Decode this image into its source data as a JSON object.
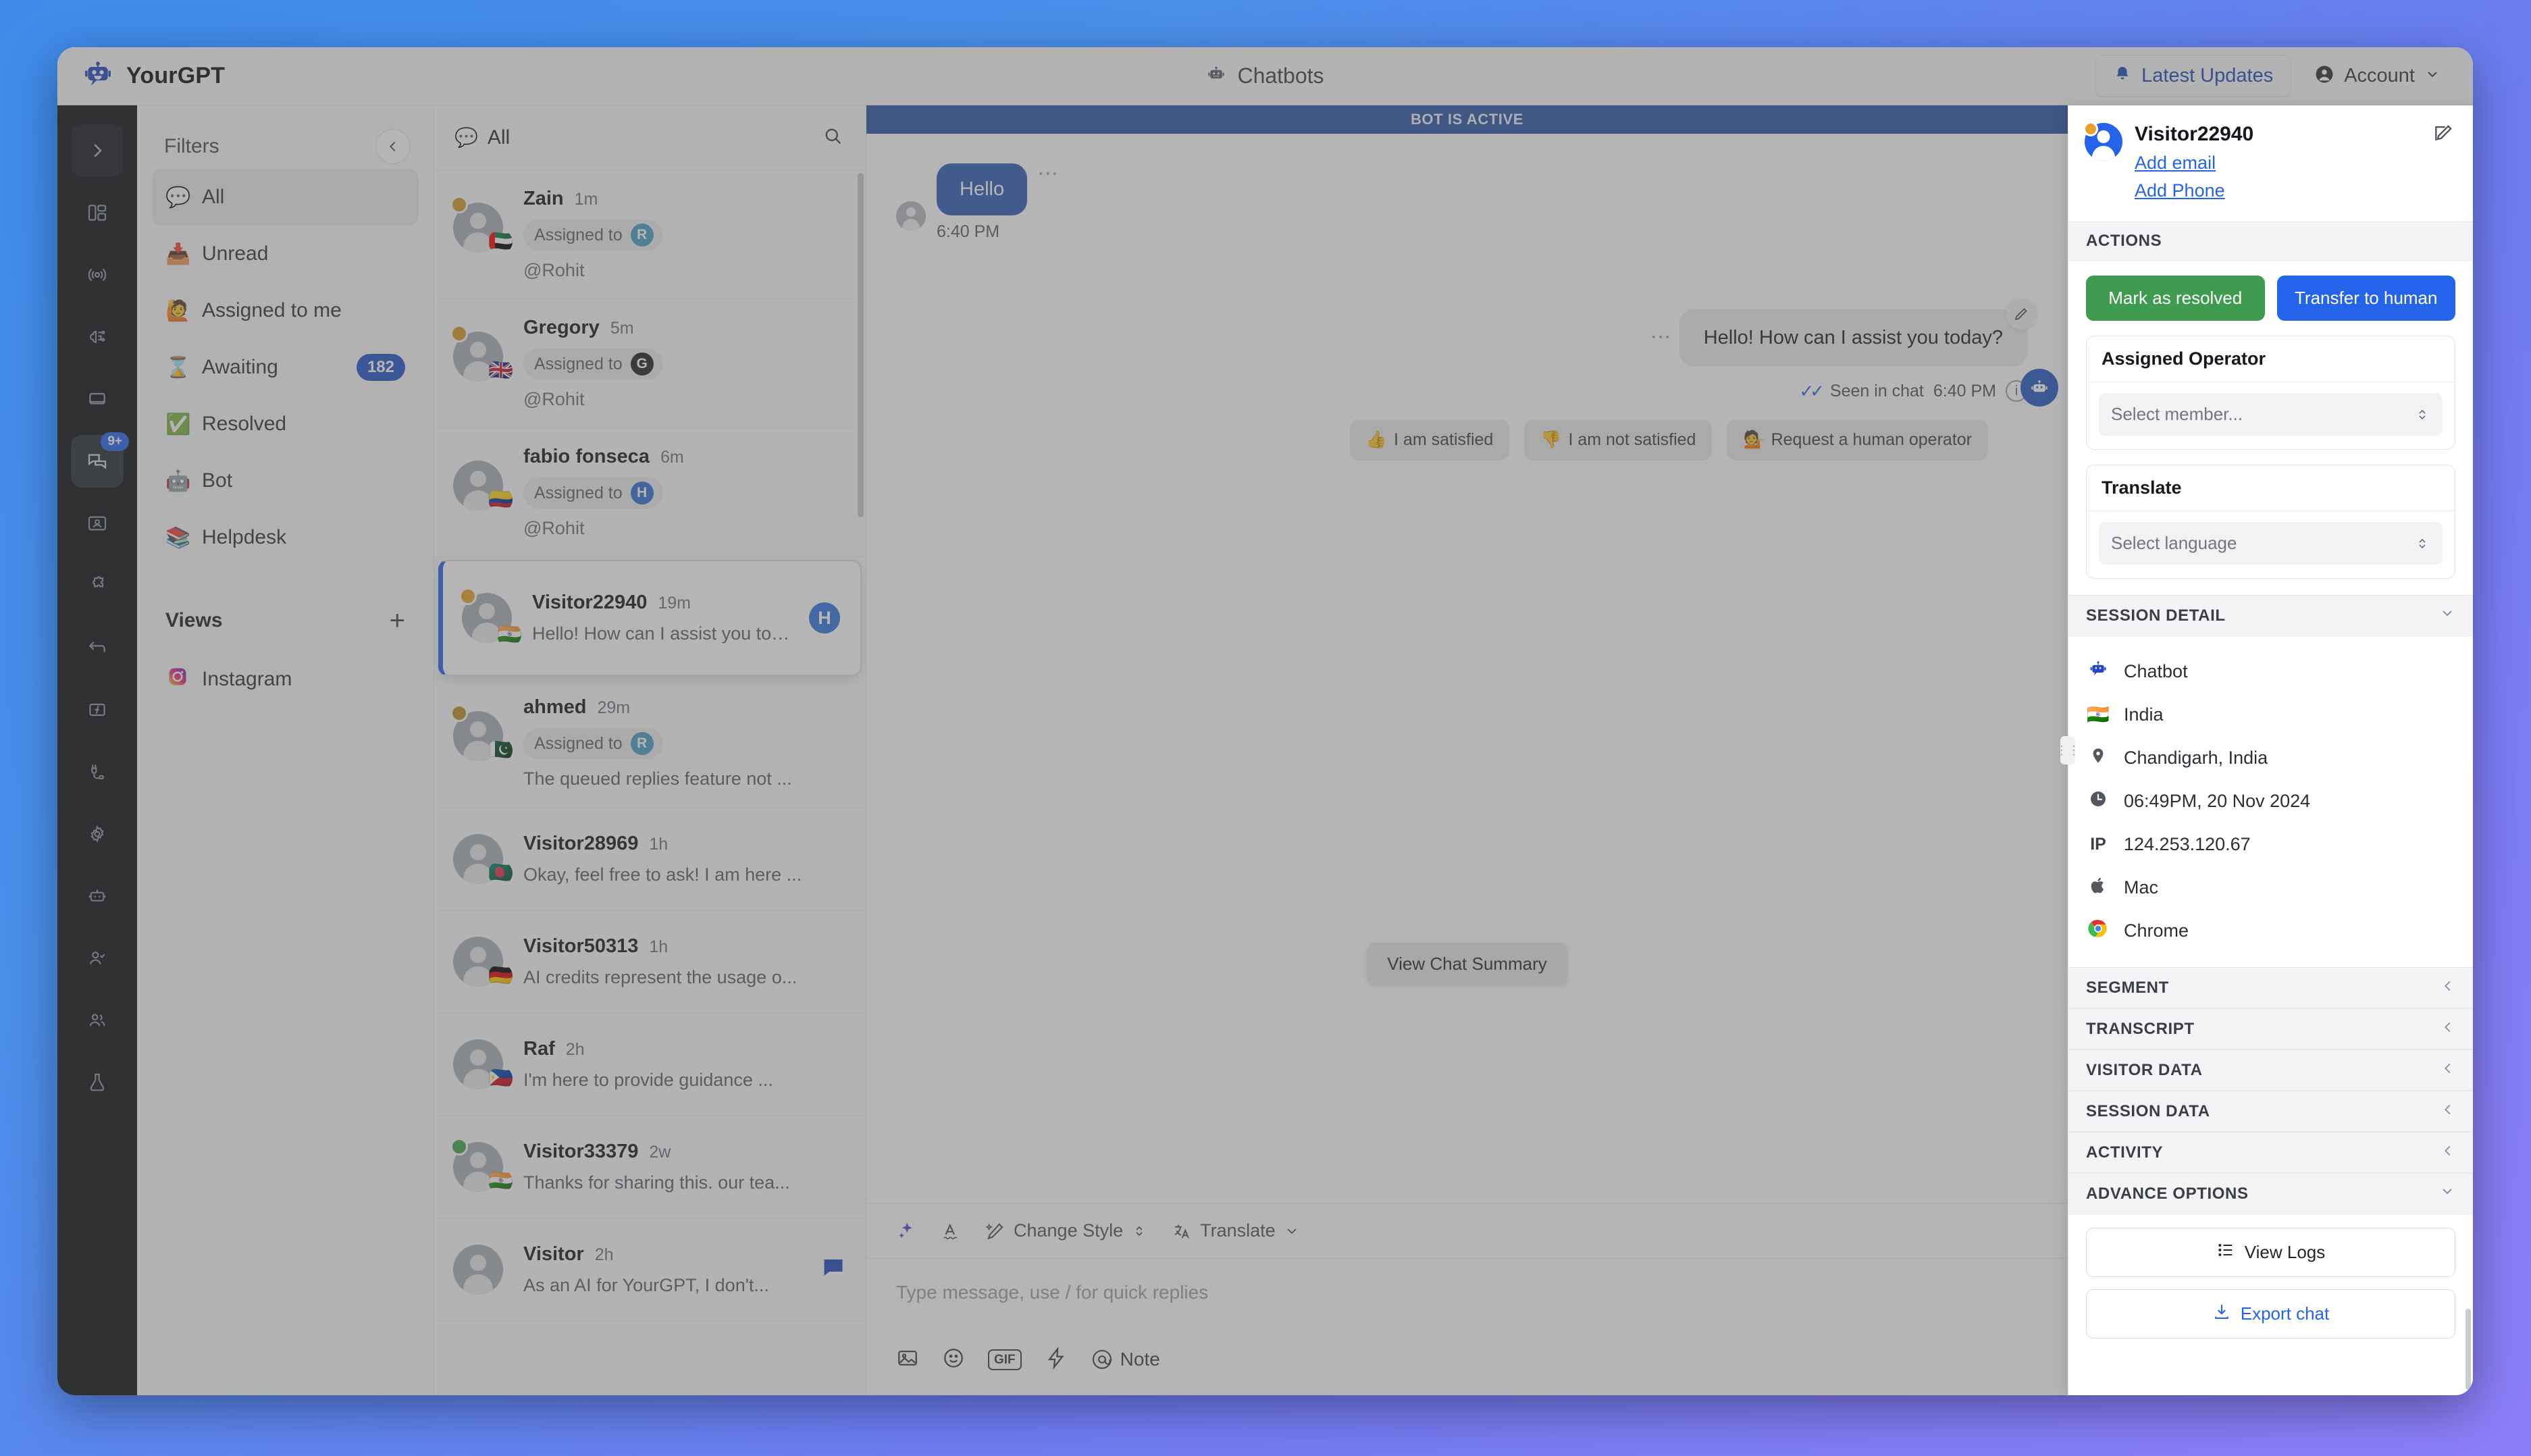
{
  "topbar": {
    "brand": "YourGPT",
    "brand_icon": "robot-logo-icon",
    "page_title": "Chatbots",
    "page_title_icon": "robot-icon",
    "updates_label": "Latest Updates",
    "updates_icon": "bell-icon",
    "account_label": "Account",
    "account_icon": "user-circle-icon",
    "account_caret": "chevron-down-icon"
  },
  "rail": {
    "items": [
      {
        "name": "expand-rail",
        "glyph": "›",
        "boxed": true
      },
      {
        "name": "dashboard",
        "glyph": "dashboard"
      },
      {
        "name": "broadcast",
        "glyph": "broadcast"
      },
      {
        "name": "ai-brain",
        "glyph": "brain"
      },
      {
        "name": "widget",
        "glyph": "widget"
      },
      {
        "name": "conversations",
        "glyph": "chats",
        "badge": "9+",
        "active": true
      },
      {
        "name": "contacts",
        "glyph": "contact-card"
      },
      {
        "name": "integrations",
        "glyph": "puzzle"
      },
      {
        "name": "back-arrow",
        "glyph": "arrow-left"
      },
      {
        "name": "functions",
        "glyph": "function"
      },
      {
        "name": "plugins",
        "glyph": "plug"
      },
      {
        "name": "settings",
        "glyph": "gear"
      },
      {
        "name": "bots",
        "glyph": "bot"
      },
      {
        "name": "agents",
        "glyph": "user-check"
      },
      {
        "name": "team",
        "glyph": "users"
      },
      {
        "name": "labs",
        "glyph": "flask"
      }
    ]
  },
  "filters": {
    "title": "Filters",
    "collapse_icon": "chevron-left-icon",
    "items": [
      {
        "emoji": "💬",
        "label": "All",
        "selected": true,
        "badge": null
      },
      {
        "emoji": "📥",
        "label": "Unread",
        "selected": false,
        "badge": null
      },
      {
        "emoji": "🙋",
        "label": "Assigned to me",
        "selected": false,
        "badge": null
      },
      {
        "emoji": "⌛",
        "label": "Awaiting",
        "selected": false,
        "badge": "182"
      },
      {
        "emoji": "✅",
        "label": "Resolved",
        "selected": false,
        "badge": null
      },
      {
        "emoji": "🤖",
        "label": "Bot",
        "selected": false,
        "badge": null
      },
      {
        "emoji": "📚",
        "label": "Helpdesk",
        "selected": false,
        "badge": null
      }
    ],
    "views_title": "Views",
    "views_add_icon": "plus-icon",
    "views": [
      {
        "emoji": "📷",
        "label": "Instagram"
      }
    ]
  },
  "conversations": {
    "header_label": "All",
    "header_emoji": "💬",
    "search_icon": "search-icon",
    "items": [
      {
        "name": "Zain",
        "time": "1m",
        "status_color": "#d9962a",
        "flag": "🇦🇪",
        "assigned_label": "Assigned to",
        "assignee_initial": "R",
        "assignee_color": "#4a9ec4",
        "handle": "@Rohit",
        "snippet": null,
        "right_avatar": null,
        "unread": false,
        "selected": false
      },
      {
        "name": "Gregory",
        "time": "5m",
        "status_color": "#d9962a",
        "flag": "🇬🇧",
        "assigned_label": "Assigned to",
        "assignee_initial": "G",
        "assignee_color": "#222222",
        "handle": "@Rohit",
        "snippet": null,
        "right_avatar": null,
        "unread": false,
        "selected": false
      },
      {
        "name": "fabio fonseca",
        "time": "6m",
        "status_color": null,
        "flag": "🇨🇴",
        "assigned_label": "Assigned to",
        "assignee_initial": "H",
        "assignee_color": "#2f76da",
        "handle": "@Rohit",
        "snippet": null,
        "right_avatar": null,
        "unread": false,
        "selected": false
      },
      {
        "name": "Visitor22940",
        "time": "19m",
        "status_color": "#e9a12c",
        "flag": "🇮🇳",
        "assigned_label": null,
        "assignee_initial": null,
        "assignee_color": null,
        "handle": null,
        "snippet": "Hello! How can I assist you toda...",
        "right_avatar": "H",
        "unread": false,
        "selected": true
      },
      {
        "name": "ahmed",
        "time": "29m",
        "status_color": "#c98f2b",
        "flag": "🇵🇰",
        "assigned_label": "Assigned to",
        "assignee_initial": "R",
        "assignee_color": "#4a9ec4",
        "handle": null,
        "snippet": "The queued replies feature not ...",
        "right_avatar": null,
        "unread": false,
        "selected": false
      },
      {
        "name": "Visitor28969",
        "time": "1h",
        "status_color": null,
        "flag": "🇧🇩",
        "assigned_label": null,
        "assignee_initial": null,
        "assignee_color": null,
        "handle": null,
        "snippet": "Okay, feel free to ask! I am here ...",
        "right_avatar": null,
        "unread": false,
        "selected": false
      },
      {
        "name": "Visitor50313",
        "time": "1h",
        "status_color": null,
        "flag": "🇩🇪",
        "assigned_label": null,
        "assignee_initial": null,
        "assignee_color": null,
        "handle": null,
        "snippet": "AI credits represent the usage o...",
        "right_avatar": null,
        "unread": false,
        "selected": false
      },
      {
        "name": "Raf",
        "time": "2h",
        "status_color": null,
        "flag": "🇵🇭",
        "assigned_label": null,
        "assignee_initial": null,
        "assignee_color": null,
        "handle": null,
        "snippet": "I'm here to provide guidance ...",
        "right_avatar": null,
        "unread": false,
        "selected": false
      },
      {
        "name": "Visitor33379",
        "time": "2w",
        "status_color": "#3ea44a",
        "flag": "🇮🇳",
        "assigned_label": null,
        "assignee_initial": null,
        "assignee_color": null,
        "handle": null,
        "snippet": "Thanks for sharing this. our tea...",
        "right_avatar": null,
        "unread": false,
        "selected": false
      },
      {
        "name": "Visitor",
        "time": "2h",
        "status_color": null,
        "flag": null,
        "assigned_label": null,
        "assignee_initial": null,
        "assignee_color": null,
        "handle": null,
        "snippet": "As an AI for YourGPT, I don't...",
        "right_avatar": null,
        "unread": true,
        "selected": false
      }
    ]
  },
  "chat": {
    "banner": "BOT IS ACTIVE",
    "messages": [
      {
        "side": "in",
        "text": "Hello",
        "time": "6:40 PM"
      },
      {
        "side": "out",
        "text": "Hello! How can I assist you today?",
        "time": "6:40 PM"
      }
    ],
    "seen_label": "Seen in chat",
    "seen_time": "6:40 PM",
    "seen_icon": "double-check-icon",
    "info_icon": "info-icon",
    "quick_replies": [
      {
        "emoji": "👍",
        "label": "I am satisfied"
      },
      {
        "emoji": "👎",
        "label": "I am not satisfied"
      },
      {
        "emoji": "💁",
        "label": "Request a human operator"
      }
    ],
    "summary_tooltip": "View Chat Summary",
    "bot_fab_icon": "robot-icon",
    "composer": {
      "placeholder": "Type message, use / for quick replies",
      "tools": [
        {
          "name": "ai-sparkle-icon",
          "label": null
        },
        {
          "name": "spellcheck-icon",
          "label": null
        },
        {
          "name": "change-style-icon",
          "label": "Change Style",
          "caret": "chevron-updown-icon"
        },
        {
          "name": "translate-icon",
          "label": "Translate",
          "caret": "chevron-down-icon"
        }
      ],
      "actions": [
        {
          "name": "image-icon",
          "label": null
        },
        {
          "name": "emoji-icon",
          "label": null
        },
        {
          "name": "gif-icon",
          "label": "GIF"
        },
        {
          "name": "lightning-icon",
          "label": null
        },
        {
          "name": "note-icon",
          "label": "Note"
        }
      ]
    }
  },
  "details": {
    "visitor_name": "Visitor22940",
    "add_email": "Add email",
    "add_phone": "Add Phone",
    "edit_icon": "edit-pencil-icon",
    "actions_title": "ACTIONS",
    "mark_resolved": "Mark as resolved",
    "transfer_human": "Transfer to human",
    "assigned_operator_label": "Assigned Operator",
    "assigned_operator_placeholder": "Select member...",
    "translate_label": "Translate",
    "translate_placeholder": "Select language",
    "session_detail_title": "SESSION DETAIL",
    "session_rows": [
      {
        "icon": "robot-icon",
        "value": "Chatbot"
      },
      {
        "icon": "flag-india-icon",
        "value": "India"
      },
      {
        "icon": "location-pin-icon",
        "value": "Chandigarh, India"
      },
      {
        "icon": "clock-icon",
        "value": "06:49PM, 20 Nov 2024"
      },
      {
        "icon": "ip-label",
        "value": "124.253.120.67"
      },
      {
        "icon": "apple-icon",
        "value": "Mac"
      },
      {
        "icon": "chrome-icon",
        "value": "Chrome"
      }
    ],
    "collapsed_sections": [
      {
        "title": "SEGMENT",
        "caret": "chevron-left-icon"
      },
      {
        "title": "TRANSCRIPT",
        "caret": "chevron-left-icon"
      },
      {
        "title": "VISITOR DATA",
        "caret": "chevron-left-icon"
      },
      {
        "title": "SESSION DATA",
        "caret": "chevron-left-icon"
      },
      {
        "title": "ACTIVITY",
        "caret": "chevron-left-icon"
      }
    ],
    "advance_options_title": "ADVANCE OPTIONS",
    "view_logs": "View Logs",
    "export_chat": "Export chat"
  },
  "colors": {
    "accent_blue": "#2563eb",
    "green": "#3f9b4f",
    "banner_blue": "#2b55a6",
    "rail_bg": "#0b0d12"
  }
}
